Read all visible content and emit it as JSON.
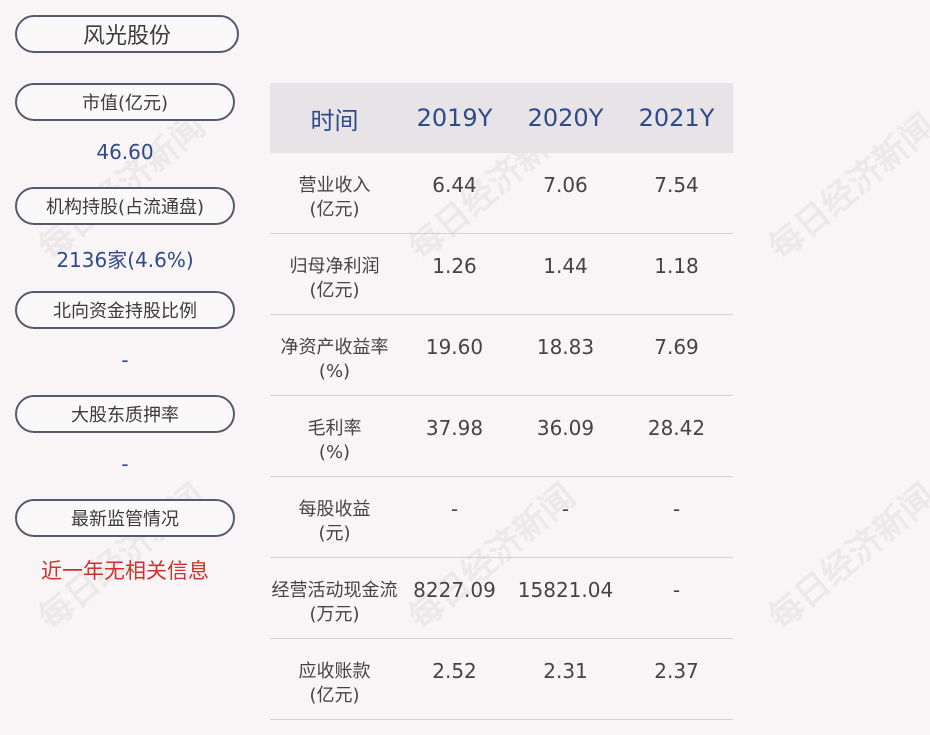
{
  "company_name": "风光股份",
  "sidebar": [
    {
      "label": "市值(亿元)",
      "value": "46.60"
    },
    {
      "label": "机构持股(占流通盘)",
      "value": "2136家(4.6%)"
    },
    {
      "label": "北向资金持股比例",
      "value": "-"
    },
    {
      "label": "大股东质押率",
      "value": "-"
    },
    {
      "label": "最新监管情况",
      "value": "近一年无相关信息"
    }
  ],
  "table": {
    "headers": [
      "时间",
      "2019Y",
      "2020Y",
      "2021Y"
    ],
    "rows": [
      {
        "metric": "营业收入",
        "unit": "(亿元)",
        "values": [
          "6.44",
          "7.06",
          "7.54"
        ]
      },
      {
        "metric": "归母净利润",
        "unit": "(亿元)",
        "values": [
          "1.26",
          "1.44",
          "1.18"
        ]
      },
      {
        "metric": "净资产收益率",
        "unit": "(%)",
        "values": [
          "19.60",
          "18.83",
          "7.69"
        ]
      },
      {
        "metric": "毛利率",
        "unit": "(%)",
        "values": [
          "37.98",
          "36.09",
          "28.42"
        ]
      },
      {
        "metric": "每股收益",
        "unit": "(元)",
        "values": [
          "-",
          "-",
          "-"
        ]
      },
      {
        "metric": "经营活动现金流",
        "unit": "(万元)",
        "values": [
          "8227.09",
          "15821.04",
          "-"
        ]
      },
      {
        "metric": "应收账款",
        "unit": "(亿元)",
        "values": [
          "2.52",
          "2.31",
          "2.37"
        ]
      }
    ]
  },
  "watermark": "每日经济新闻",
  "colors": {
    "accent_blue": "#2e4a8a",
    "alert_red": "#d0312d",
    "header_bg": "#e8e3e6",
    "page_bg": "#f9f5f6"
  }
}
